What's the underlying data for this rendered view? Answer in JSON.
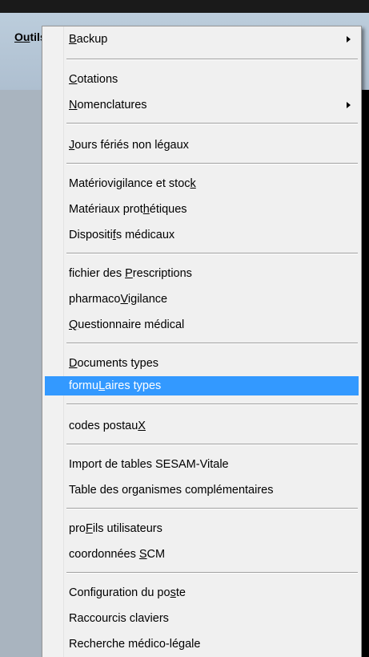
{
  "menubar": {
    "active_menu": {
      "accel": "Ou",
      "rest": "tils"
    },
    "help_menu": "?"
  },
  "dropdown": {
    "items": [
      {
        "pre": "",
        "acc": "B",
        "post": "ackup",
        "submenu": true
      },
      {
        "pre": "",
        "acc": "C",
        "post": "otations"
      },
      {
        "pre": "",
        "acc": "N",
        "post": "omenclatures",
        "submenu": true
      },
      {
        "pre": "",
        "acc": "J",
        "post": "ours fériés non légaux"
      },
      {
        "pre": "Matériovigilance et stoc",
        "acc": "k",
        "post": ""
      },
      {
        "pre": "Matériaux prot",
        "acc": "h",
        "post": "étiques"
      },
      {
        "pre": "Dispositi",
        "acc": "f",
        "post": "s médicaux"
      },
      {
        "pre": "fichier des ",
        "acc": "P",
        "post": "rescriptions"
      },
      {
        "pre": "pharmaco",
        "acc": "V",
        "post": "igilance"
      },
      {
        "pre": "",
        "acc": "Q",
        "post": "uestionnaire médical"
      },
      {
        "pre": "",
        "acc": "D",
        "post": "ocuments types"
      },
      {
        "pre": "formu",
        "acc": "L",
        "post": "aires types",
        "highlighted": true
      },
      {
        "pre": "codes postau",
        "acc": "X",
        "post": ""
      },
      {
        "pre": "Import de tables SESAM-Vitale",
        "acc": "",
        "post": ""
      },
      {
        "pre": "Table des organismes complémentaires",
        "acc": "",
        "post": ""
      },
      {
        "pre": "pro",
        "acc": "F",
        "post": "ils utilisateurs"
      },
      {
        "pre": "coordonnées ",
        "acc": "S",
        "post": "CM"
      },
      {
        "pre": "Configuration du po",
        "acc": "s",
        "post": "te"
      },
      {
        "pre": "Raccourcis claviers",
        "acc": "",
        "post": ""
      },
      {
        "pre": "Recherche médico-légale",
        "acc": "",
        "post": ""
      }
    ]
  },
  "colors": {
    "highlight": "#3399ff",
    "menu_bg": "#f0f0f0",
    "menubar_bg": "#b4c5d6"
  }
}
